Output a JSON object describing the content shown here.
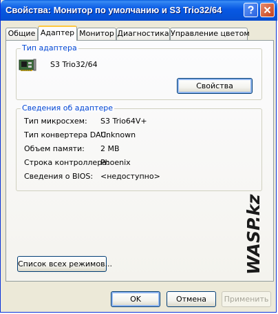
{
  "window": {
    "title": "Свойства: Монитор по умолчанию и S3 Trio32/64"
  },
  "tabs": [
    {
      "label": "Общие"
    },
    {
      "label": "Адаптер"
    },
    {
      "label": "Монитор"
    },
    {
      "label": "Диагностика"
    },
    {
      "label": "Управление цветом"
    }
  ],
  "adapter_type": {
    "group_title": "Тип адаптера",
    "icon": "video-card-icon",
    "name": "S3 Trio32/64",
    "properties_button": "Свойства"
  },
  "adapter_info": {
    "group_title": "Сведения об адаптере",
    "rows": [
      {
        "label": "Тип микросхем:",
        "value": "S3 Trio64V+"
      },
      {
        "label": "Тип конвертера DAC:",
        "value": "Unknown"
      },
      {
        "label": "Объем памяти:",
        "value": "2 MB"
      },
      {
        "label": "Строка контроллера:",
        "value": "Phoenix"
      },
      {
        "label": "Сведения о BIOS:",
        "value": "<недоступно>"
      }
    ]
  },
  "list_modes_button": "Список всех режимов...",
  "footer": {
    "ok": "OK",
    "cancel": "Отмена",
    "apply": "Применить"
  },
  "watermark": "WASP.kz",
  "colors": {
    "title_bar": "#0858e3",
    "group_title": "#0046d5",
    "active_tab_accent": "#ffc73c"
  }
}
